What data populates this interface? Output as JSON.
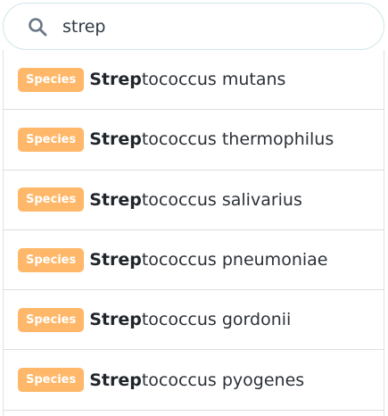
{
  "search": {
    "value": "strep",
    "icon": "search-icon"
  },
  "results": [
    {
      "badge": "Species",
      "match": "Strep",
      "rest": "tococcus mutans"
    },
    {
      "badge": "Species",
      "match": "Strep",
      "rest": "tococcus thermophilus"
    },
    {
      "badge": "Species",
      "match": "Strep",
      "rest": "tococcus salivarius"
    },
    {
      "badge": "Species",
      "match": "Strep",
      "rest": "tococcus pneumoniae"
    },
    {
      "badge": "Species",
      "match": "Strep",
      "rest": "tococcus gordonii"
    },
    {
      "badge": "Species",
      "match": "Strep",
      "rest": "tococcus pyogenes"
    }
  ],
  "colors": {
    "badge_bg": "#ffb869",
    "search_border": "#cfe6e9",
    "icon": "#5f6f80"
  }
}
